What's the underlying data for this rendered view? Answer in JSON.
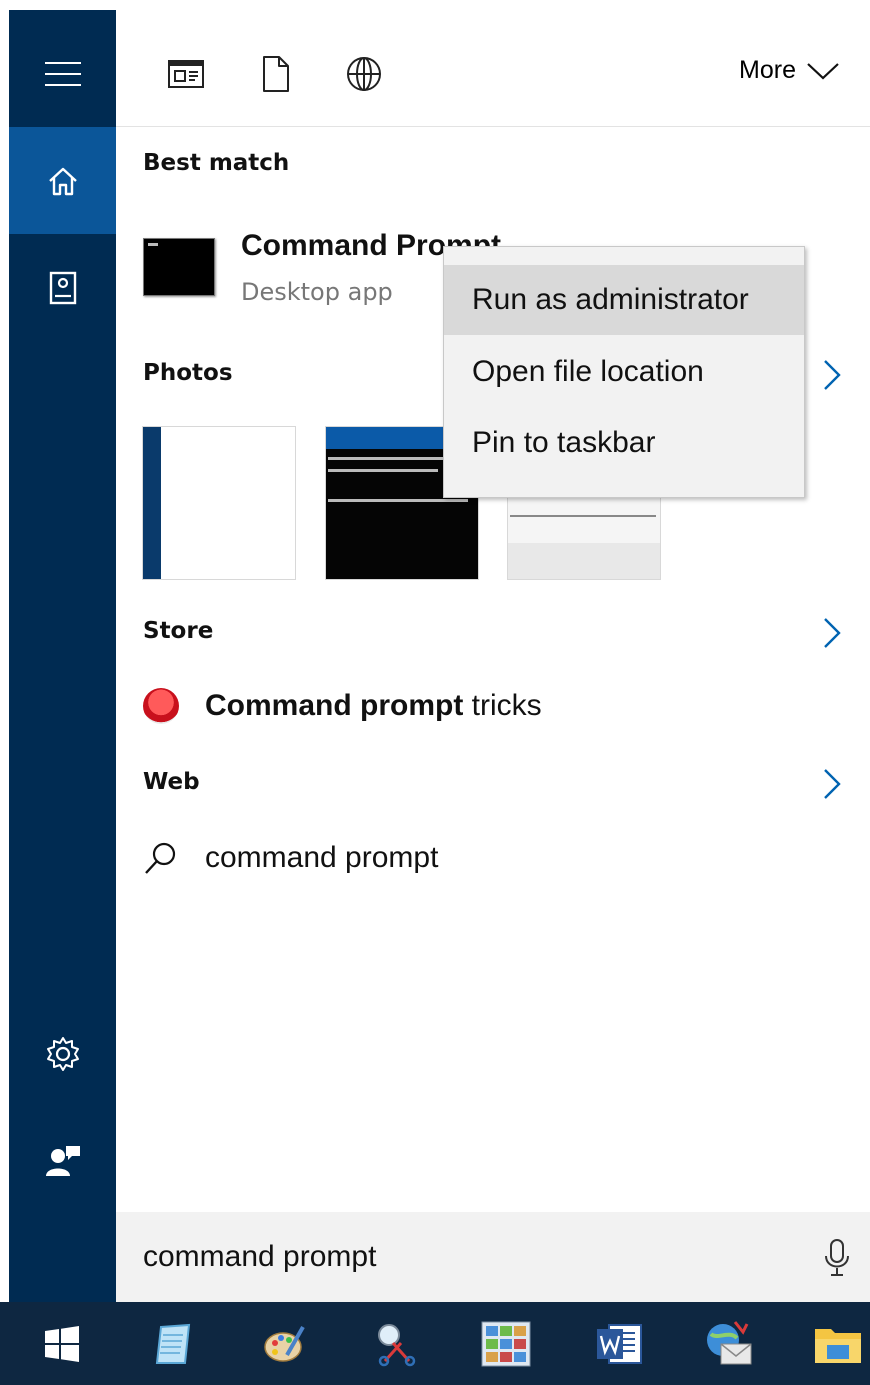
{
  "toolbar": {
    "filters": [
      "apps-filter-icon",
      "documents-filter-icon",
      "web-filter-icon"
    ],
    "more_label": "More"
  },
  "sidebar": {
    "items": [
      {
        "icon": "hamburger-menu-icon"
      },
      {
        "icon": "home-icon",
        "active": true
      },
      {
        "icon": "notebook-icon"
      },
      {
        "icon": "gear-icon"
      },
      {
        "icon": "feedback-icon"
      }
    ]
  },
  "best_match": {
    "heading": "Best match",
    "app_name": "Command Prompt",
    "app_type": "Desktop app"
  },
  "photos": {
    "heading": "Photos"
  },
  "store": {
    "heading": "Store",
    "result_bold": "Command prompt",
    "result_rest": " tricks"
  },
  "web": {
    "heading": "Web",
    "result": "command prompt"
  },
  "search": {
    "value": "command prompt"
  },
  "context_menu": {
    "items": [
      "Run as administrator",
      "Open file location",
      "Pin to taskbar"
    ],
    "highlighted_index": 0
  },
  "taskbar": {
    "apps": [
      "windows-start-icon",
      "notepad-icon",
      "paint-icon",
      "snipping-tool-icon",
      "photo-gallery-icon",
      "word-icon",
      "mail-icon",
      "file-explorer-icon"
    ]
  },
  "colors": {
    "rail": "#002b52",
    "rail_active": "#0b5699",
    "accent": "#0063b1",
    "taskbar": "#0e2741"
  }
}
